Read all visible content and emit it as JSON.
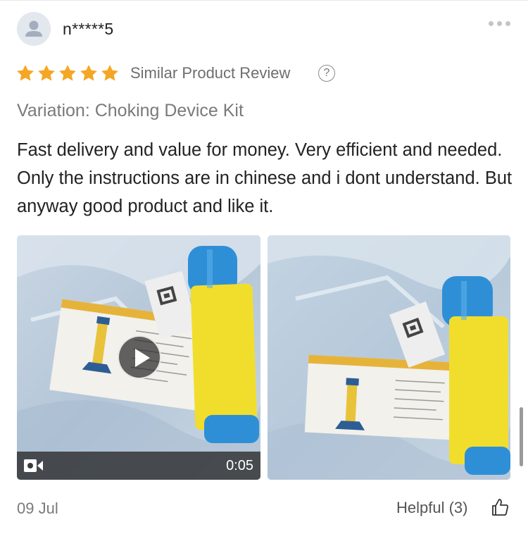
{
  "review": {
    "username": "n*****5",
    "rating": 5,
    "rating_max": 5,
    "review_type": "Similar Product Review",
    "help_icon_glyph": "?",
    "variation": "Variation: Choking Device Kit",
    "text": "Fast delivery and value for money. Very efficient and needed. Only the instructions are in chinese and i dont understand. But anyway good product and like it.",
    "date": "09 Jul",
    "helpful_label": "Helpful (3)",
    "media": [
      {
        "kind": "video",
        "duration": "0:05",
        "icon": "video-camera-icon",
        "overlay": "play-icon"
      },
      {
        "kind": "photo"
      }
    ]
  },
  "icons": {
    "avatar": "person-icon",
    "more": "more-dots-icon",
    "star": "star-icon",
    "help": "question-circle-icon",
    "helpful": "thumbs-up-icon"
  },
  "colors": {
    "star": "#f5a623",
    "secondary_text": "#7a7a7a",
    "primary_text": "#222222"
  }
}
